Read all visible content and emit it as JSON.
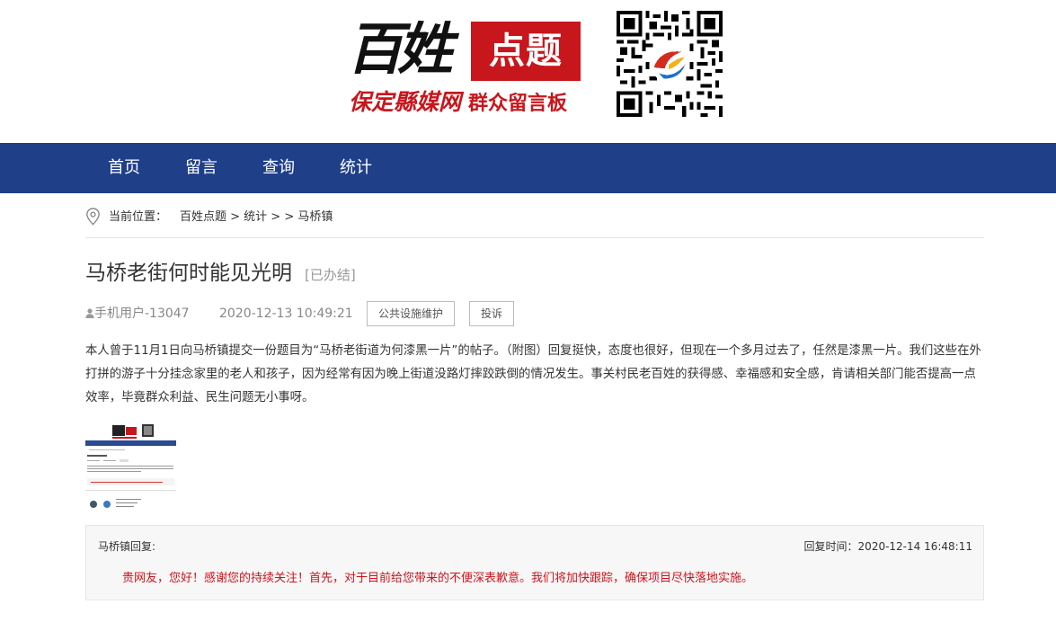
{
  "logo": {
    "main_text": "百姓",
    "badge_text": "点题",
    "sub_site": "保定縣媒网",
    "sub_board": "群众留言板"
  },
  "nav": {
    "items": [
      {
        "label": "首页"
      },
      {
        "label": "留言"
      },
      {
        "label": "查询"
      },
      {
        "label": "统计"
      }
    ]
  },
  "breadcrumb": {
    "label": "当前位置：",
    "path": "百姓点题 > 统计 > > 马桥镇"
  },
  "post": {
    "title": "马桥老街何时能见光明",
    "status": "[已办结]",
    "user": "手机用户-13047",
    "time": "2020-12-13 10:49:21",
    "category": "公共设施维护",
    "complaint": "投诉",
    "body": "本人曾于11月1日向马桥镇提交一份题目为“马桥老街道为何漆黑一片”的帖子。（附图）回复挺快，态度也很好，但现在一个多月过去了，任然是漆黑一片。我们这些在外打拼的游子十分挂念家里的老人和孩子，因为经常有因为晚上街道没路灯摔跤跌倒的情况发生。事关村民老百姓的获得感、幸福感和安全感，肯请相关部门能否提高一点效率，毕竟群众利益、民生问题无小事呀。"
  },
  "reply": {
    "who": "马桥镇回复:",
    "time_label": "回复时间：2020-12-14 16:48:11",
    "text": "贵网友，您好！感谢您的持续关注！首先，对于目前给您带来的不便深表歉意。我们将加快跟踪，确保项目尽快落地实施。"
  },
  "colors": {
    "nav_bg": "#1f3f89",
    "brand_red": "#c8161d",
    "reply_red": "#d0121b"
  }
}
